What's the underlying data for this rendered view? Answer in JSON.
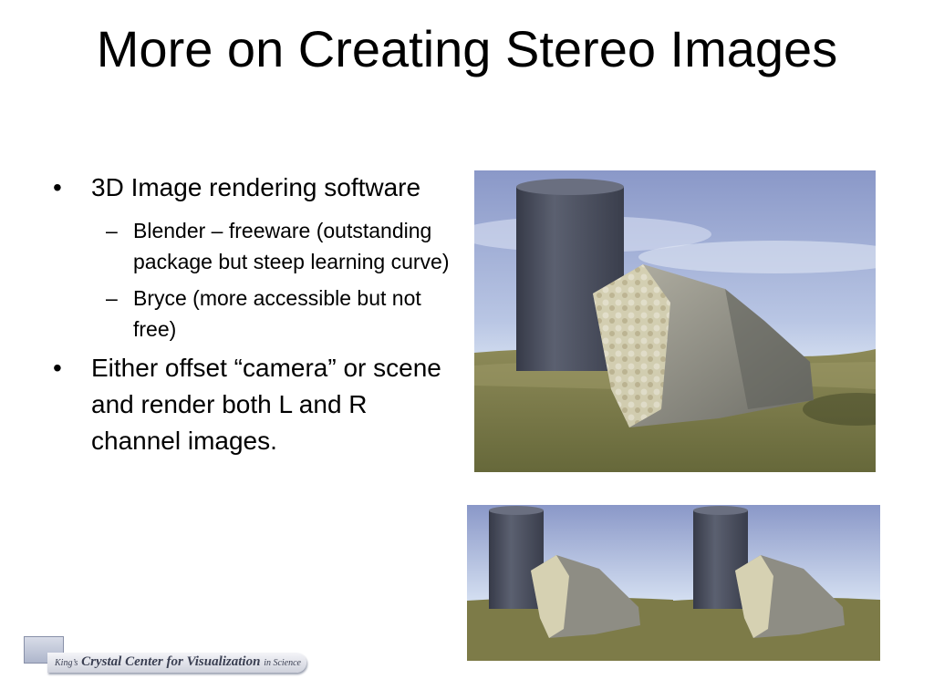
{
  "slide": {
    "title": "More on Creating Stereo Images",
    "bullets": [
      {
        "text": "3D Image rendering software",
        "sub": [
          "Blender – freeware (outstanding package but steep learning curve)",
          "Bryce (more accessible but not free)"
        ]
      },
      {
        "text": "Either offset “camera” or scene and render both L and R channel images.",
        "sub": []
      }
    ],
    "bullet_marker": "•",
    "sub_marker": "–"
  },
  "footer": {
    "logo_prefix": "King’s",
    "logo_main": "Crystal Center for Visualization",
    "logo_suffix": "in Science"
  },
  "colors": {
    "sky": "#8f9fd0",
    "horizon": "#e9f2fb",
    "ground": "#77753f",
    "cylinder": "#4b5060",
    "rock": "#8c8c80"
  }
}
